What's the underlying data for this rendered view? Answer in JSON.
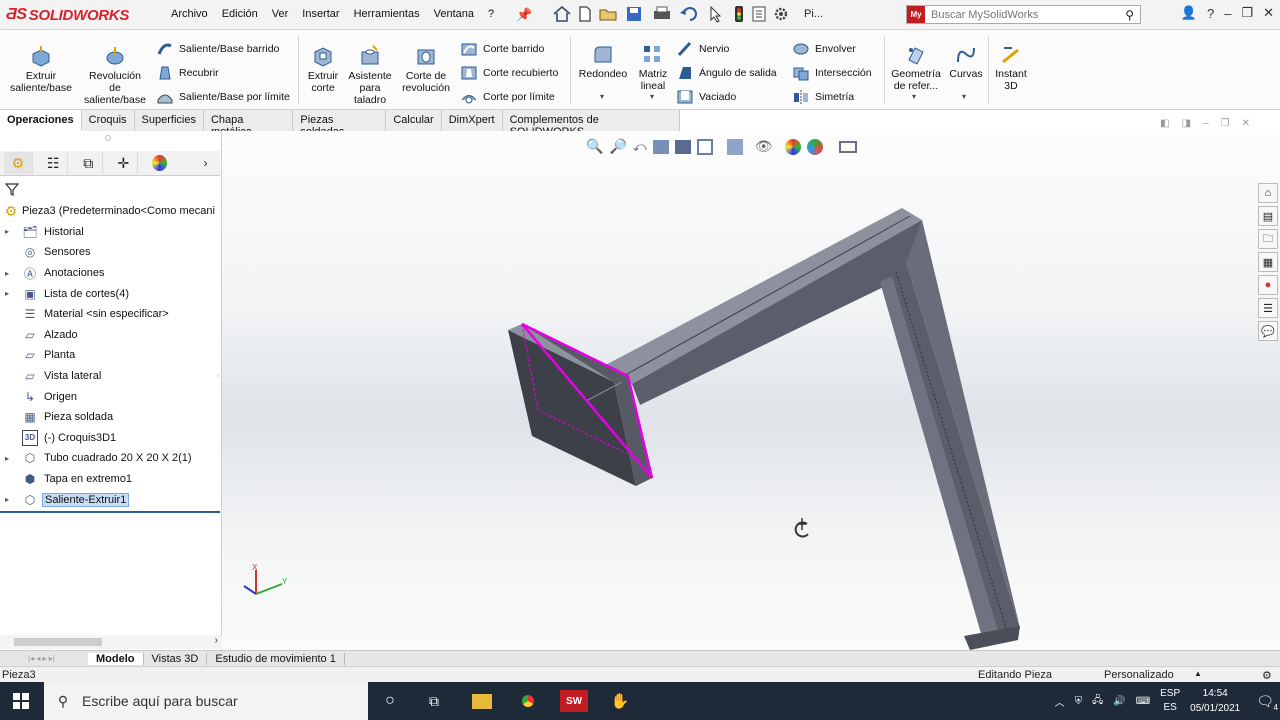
{
  "app": {
    "logo": "SOLIDWORKS"
  },
  "menu": [
    "Archivo",
    "Edición",
    "Ver",
    "Insertar",
    "Herramientas",
    "Ventana",
    "?"
  ],
  "search": {
    "placeholder": "Buscar MySolidWorks",
    "badge": "My"
  },
  "quick_truncated_label": "Pi...",
  "ribbon": {
    "extruir_saliente": "Extruir saliente/base",
    "revolucion_saliente": "Revolución de saliente/base",
    "saliente_barrido": "Saliente/Base barrido",
    "recubrir": "Recubrir",
    "saliente_limite": "Saliente/Base por límite",
    "extruir_corte": "Extruir corte",
    "asistente_taladro": "Asistente para taladro",
    "corte_revolucion": "Corte de revolución",
    "corte_barrido": "Corte barrido",
    "corte_recubierto": "Corte recubierto",
    "corte_limite": "Corte por límite",
    "redondeo": "Redondeo",
    "matriz_lineal": "Matriz lineal",
    "nervio": "Nervio",
    "angulo_salida": "Ángulo de salida",
    "vaciado": "Vaciado",
    "envolver": "Envolver",
    "interseccion": "Intersección",
    "simetria": "Simetría",
    "geometria_ref": "Geometría de refer...",
    "curvas": "Curvas",
    "instant3d": "Instant 3D"
  },
  "tabs": [
    "Operaciones",
    "Croquis",
    "Superficies",
    "Chapa metálica",
    "Piezas soldadas",
    "Calcular",
    "DimXpert",
    "Complementos de SOLIDWORKS"
  ],
  "tree": {
    "root": "Pieza3  (Predeterminado<Como mecani",
    "items": [
      {
        "label": "Historial",
        "icon": "folder-history-icon",
        "expand": true
      },
      {
        "label": "Sensores",
        "icon": "sensor-icon",
        "expand": false
      },
      {
        "label": "Anotaciones",
        "icon": "annotations-icon",
        "expand": true
      },
      {
        "label": "Lista de cortes(4)",
        "icon": "cut-list-icon",
        "expand": true
      },
      {
        "label": "Material <sin especificar>",
        "icon": "material-icon",
        "expand": false
      },
      {
        "label": "Alzado",
        "icon": "plane-icon",
        "expand": false
      },
      {
        "label": "Planta",
        "icon": "plane-icon",
        "expand": false
      },
      {
        "label": "Vista lateral",
        "icon": "plane-icon",
        "expand": false
      },
      {
        "label": "Origen",
        "icon": "origin-icon",
        "expand": false
      },
      {
        "label": "Pieza soldada",
        "icon": "weldment-icon",
        "expand": false
      },
      {
        "label": "(-) Croquis3D1",
        "icon": "sketch3d-icon",
        "expand": false
      },
      {
        "label": "Tubo cuadrado 20 X 20 X 2(1)",
        "icon": "structural-member-icon",
        "expand": true
      },
      {
        "label": "Tapa en extremo1",
        "icon": "end-cap-icon",
        "expand": false
      },
      {
        "label": "Saliente-Extruir1",
        "icon": "extrude-icon",
        "expand": true,
        "selected": true
      }
    ]
  },
  "bottom_tabs": [
    "Modelo",
    "Vistas 3D",
    "Estudio de movimiento 1"
  ],
  "status": {
    "left": "Pieza3",
    "mid": "Editando Pieza",
    "right": "Personalizado"
  },
  "taskbar": {
    "search": "Escribe aquí para buscar",
    "lang1": "ESP",
    "lang2": "ES",
    "time": "14:54",
    "date": "05/01/2021",
    "notif": "4",
    "sw_badge": "SW"
  },
  "triad": {
    "x": "X",
    "y": "Y"
  },
  "colors": {
    "accent": "#c31d24",
    "selection": "#e600e6",
    "model": "#5d5f6b",
    "taskbar": "#1e2a38"
  }
}
